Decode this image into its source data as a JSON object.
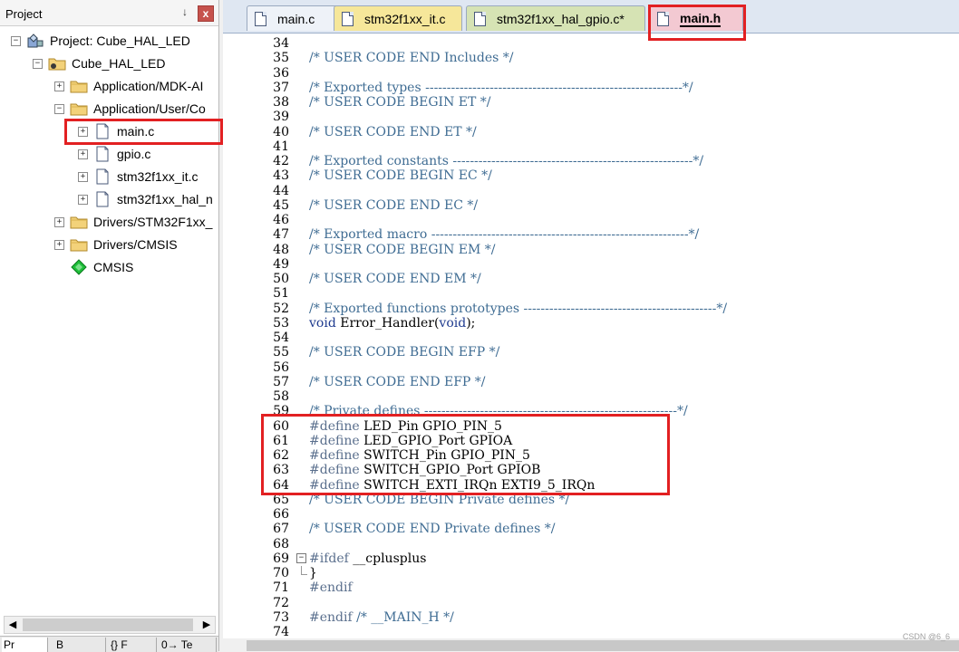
{
  "project_panel": {
    "title": "Project",
    "pin_glyph": "↓",
    "close_glyph": "x",
    "tree": [
      {
        "label": "Project: Cube_HAL_LED",
        "icon": "project-icon",
        "expander": "−"
      },
      {
        "label": "Cube_HAL_LED",
        "icon": "target-folder-icon",
        "expander": "−"
      },
      {
        "label": "Application/MDK-AI",
        "icon": "folder-icon",
        "expander": "+"
      },
      {
        "label": "Application/User/Co",
        "icon": "folder-open-icon",
        "expander": "−"
      },
      {
        "label": "main.c",
        "icon": "file-icon",
        "expander": "+"
      },
      {
        "label": "gpio.c",
        "icon": "file-icon",
        "expander": "+"
      },
      {
        "label": "stm32f1xx_it.c",
        "icon": "file-icon",
        "expander": "+"
      },
      {
        "label": "stm32f1xx_hal_n",
        "icon": "file-icon",
        "expander": "+"
      },
      {
        "label": "Drivers/STM32F1xx_",
        "icon": "folder-icon",
        "expander": "+"
      },
      {
        "label": "Drivers/CMSIS",
        "icon": "folder-icon",
        "expander": "+"
      },
      {
        "label": "CMSIS",
        "icon": "cmsis-gem-icon",
        "expander": ""
      }
    ],
    "bottom_tabs": [
      "Pr",
      "B",
      "{} F",
      "0→ Te"
    ]
  },
  "editor_tabs": [
    {
      "label": "main.c",
      "active": false,
      "color": "#dfe7f2"
    },
    {
      "label": "stm32f1xx_it.c",
      "active": false,
      "color": "#f6e79a"
    },
    {
      "label": "stm32f1xx_hal_gpio.c*",
      "active": false,
      "color": "#d6e3b4"
    },
    {
      "label": "main.h",
      "active": true,
      "color": "#f3c9d2"
    }
  ],
  "code": [
    {
      "n": "34",
      "segments": []
    },
    {
      "n": "35",
      "segments": [
        {
          "t": "/* USER CODE END Includes */",
          "c": "comment"
        }
      ]
    },
    {
      "n": "36",
      "segments": []
    },
    {
      "n": "37",
      "segments": [
        {
          "t": "/* Exported types ------------------------------------------------------------*/",
          "c": "comment"
        }
      ]
    },
    {
      "n": "38",
      "segments": [
        {
          "t": "/* USER CODE BEGIN ET */",
          "c": "comment"
        }
      ]
    },
    {
      "n": "39",
      "segments": []
    },
    {
      "n": "40",
      "segments": [
        {
          "t": "/* USER CODE END ET */",
          "c": "comment"
        }
      ]
    },
    {
      "n": "41",
      "segments": []
    },
    {
      "n": "42",
      "segments": [
        {
          "t": "/* Exported constants --------------------------------------------------------*/",
          "c": "comment"
        }
      ]
    },
    {
      "n": "43",
      "segments": [
        {
          "t": "/* USER CODE BEGIN EC */",
          "c": "comment"
        }
      ]
    },
    {
      "n": "44",
      "segments": []
    },
    {
      "n": "45",
      "segments": [
        {
          "t": "/* USER CODE END EC */",
          "c": "comment"
        }
      ]
    },
    {
      "n": "46",
      "segments": []
    },
    {
      "n": "47",
      "segments": [
        {
          "t": "/* Exported macro ------------------------------------------------------------*/",
          "c": "comment"
        }
      ]
    },
    {
      "n": "48",
      "segments": [
        {
          "t": "/* USER CODE BEGIN EM */",
          "c": "comment"
        }
      ]
    },
    {
      "n": "49",
      "segments": []
    },
    {
      "n": "50",
      "segments": [
        {
          "t": "/* USER CODE END EM */",
          "c": "comment"
        }
      ]
    },
    {
      "n": "51",
      "segments": []
    },
    {
      "n": "52",
      "segments": [
        {
          "t": "/* Exported functions prototypes ---------------------------------------------*/",
          "c": "comment"
        }
      ]
    },
    {
      "n": "53",
      "segments": [
        {
          "t": "void",
          "c": "kw"
        },
        {
          "t": " Error_Handler(",
          "c": "plain"
        },
        {
          "t": "void",
          "c": "kw"
        },
        {
          "t": ");",
          "c": "plain"
        }
      ]
    },
    {
      "n": "54",
      "segments": []
    },
    {
      "n": "55",
      "segments": [
        {
          "t": "/* USER CODE BEGIN EFP */",
          "c": "comment"
        }
      ]
    },
    {
      "n": "56",
      "segments": []
    },
    {
      "n": "57",
      "segments": [
        {
          "t": "/* USER CODE END EFP */",
          "c": "comment"
        }
      ]
    },
    {
      "n": "58",
      "segments": []
    },
    {
      "n": "59",
      "segments": [
        {
          "t": "/* Private defines -----------------------------------------------------------*/",
          "c": "comment"
        }
      ]
    },
    {
      "n": "60",
      "segments": [
        {
          "t": "#define",
          "c": "pre"
        },
        {
          "t": " LED_Pin GPIO_PIN_5",
          "c": "plain"
        }
      ]
    },
    {
      "n": "61",
      "segments": [
        {
          "t": "#define",
          "c": "pre"
        },
        {
          "t": " LED_GPIO_Port GPIOA",
          "c": "plain"
        }
      ]
    },
    {
      "n": "62",
      "segments": [
        {
          "t": "#define",
          "c": "pre"
        },
        {
          "t": " SWITCH_Pin GPIO_PIN_5",
          "c": "plain"
        }
      ]
    },
    {
      "n": "63",
      "segments": [
        {
          "t": "#define",
          "c": "pre"
        },
        {
          "t": " SWITCH_GPIO_Port GPIOB",
          "c": "plain"
        }
      ]
    },
    {
      "n": "64",
      "segments": [
        {
          "t": "#define",
          "c": "pre"
        },
        {
          "t": " SWITCH_EXTI_IRQn EXTI9_5_IRQn",
          "c": "plain"
        }
      ]
    },
    {
      "n": "65",
      "segments": [
        {
          "t": "/* USER CODE BEGIN Private defines */",
          "c": "comment"
        }
      ]
    },
    {
      "n": "66",
      "segments": []
    },
    {
      "n": "67",
      "segments": [
        {
          "t": "/* USER CODE END Private defines */",
          "c": "comment"
        }
      ]
    },
    {
      "n": "68",
      "segments": []
    },
    {
      "n": "69",
      "segments": [
        {
          "t": "#ifdef",
          "c": "pre"
        },
        {
          "t": " __cplusplus",
          "c": "plain"
        }
      ],
      "fold": "start"
    },
    {
      "n": "70",
      "segments": [
        {
          "t": "}",
          "c": "plain"
        }
      ],
      "fold": "end"
    },
    {
      "n": "71",
      "segments": [
        {
          "t": "#endif",
          "c": "pre"
        }
      ]
    },
    {
      "n": "72",
      "segments": []
    },
    {
      "n": "73",
      "segments": [
        {
          "t": "#endif",
          "c": "pre"
        },
        {
          "t": " /* __MAIN_H */",
          "c": "comment"
        }
      ]
    },
    {
      "n": "74",
      "segments": []
    }
  ],
  "colors": {
    "highlight": "#e22022",
    "comment": "#3f6c93",
    "preprocessor": "#5a6f8d",
    "keyword": "#1f3b8f"
  },
  "watermark": "CSDN @6_6"
}
